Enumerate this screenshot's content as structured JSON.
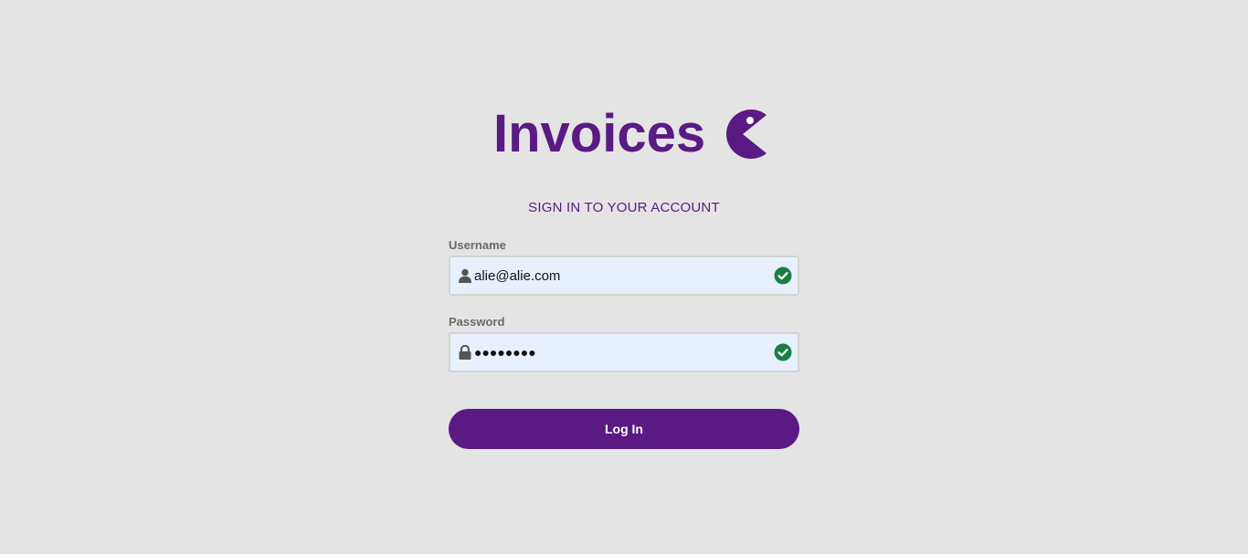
{
  "brand": {
    "title": "Invoices",
    "logo_icon": "pacman-logo-icon",
    "color": "#5a1a83"
  },
  "heading": "SIGN IN TO YOUR ACCOUNT",
  "form": {
    "username": {
      "label": "Username",
      "value": "alie@alie.com",
      "icon": "user-icon",
      "status_icon": "check-circle-icon"
    },
    "password": {
      "label": "Password",
      "masked_value": "●●●●●●●●",
      "icon": "lock-icon",
      "status_icon": "check-circle-icon"
    },
    "submit_label": "Log In"
  },
  "colors": {
    "background": "#e4e4e4",
    "accent": "#5a1a83",
    "input_bg": "#e8f0fe",
    "valid": "#1a7f45"
  }
}
